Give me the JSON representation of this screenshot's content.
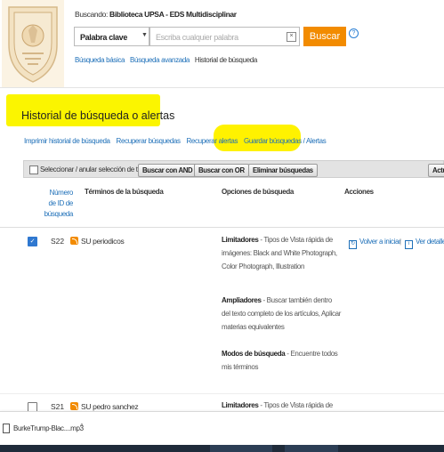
{
  "header": {
    "searching_prefix": "Buscando:",
    "searching_db": "Biblioteca UPSA - EDS Multidisciplinar",
    "field_select": "Palabra clave",
    "search_placeholder": "Escriba cualquier palabra",
    "search_button": "Buscar",
    "help_glyph": "?",
    "links": [
      "Búsqueda básica",
      "Búsqueda avanzada",
      "Historial de búsqueda"
    ]
  },
  "page_title": "Historial de búsqueda o alertas",
  "action_links": [
    "Imprimir historial de búsqueda",
    "Recuperar búsquedas",
    "Recuperar alertas",
    "Guardar búsquedas / Alertas"
  ],
  "toolbar": {
    "select_all": "Seleccionar / anular selección de todo",
    "btn_and": "Buscar con AND",
    "btn_or": "Buscar con OR",
    "btn_delete": "Eliminar búsquedas",
    "btn_update": "Actu"
  },
  "table_headers": {
    "id": [
      "Número",
      "de ID de",
      "búsqueda"
    ],
    "terms": "Términos de la búsqueda",
    "options": "Opciones de búsqueda",
    "actions": "Acciones"
  },
  "rows": [
    {
      "id": "S22",
      "term": "SU periodicos",
      "checked": true,
      "limiters_label": "Limitadores",
      "limiters_text": " - Tipos de Vista rápida de imágenes: Black and White Photograph, Color Photograph, Illustration",
      "expanders_label": "Ampliadores",
      "expanders_text": " - Buscar también dentro del texto completo de los artículos, Aplicar materias equivalentes",
      "modes_label": "Modos de búsqueda",
      "modes_text": " - Encuentre todos mis términos",
      "action_rerun": "Volver a iniciar",
      "action_details": "Ver detalles"
    },
    {
      "id": "S21",
      "term": "SU pedro sanchez",
      "checked": false,
      "limiters_label": "Limitadores",
      "limiters_text": " - Tipos de Vista rápida de"
    }
  ],
  "download_bar": {
    "file_name": "BurkeTrump-Blac....mp3",
    "caret": "^"
  },
  "colors": {
    "accent_orange": "#f28b00",
    "link_blue": "#1d6fb8",
    "highlight_yellow": "#fbf500"
  }
}
